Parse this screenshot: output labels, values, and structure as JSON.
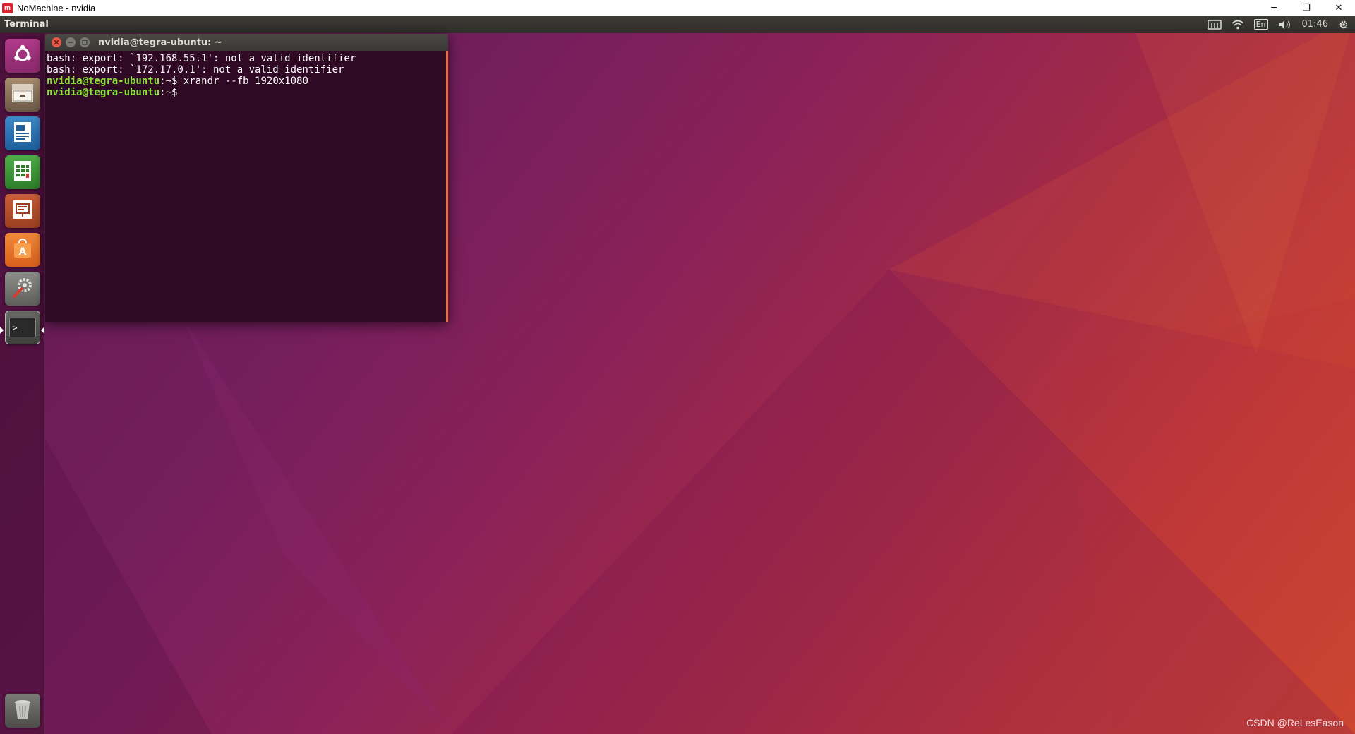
{
  "host_window": {
    "logo_text": "m",
    "title": "NoMachine - nvidia",
    "controls": {
      "minimize": "─",
      "restore": "❐",
      "close": "✕"
    }
  },
  "top_panel": {
    "app_name": "Terminal",
    "tray": {
      "keyboard_badge": "En",
      "clock": "01:46"
    }
  },
  "launcher": {
    "items": [
      {
        "name": "ubuntu-dash",
        "icon": "ubuntu-logo-icon"
      },
      {
        "name": "files",
        "icon": "file-cabinet-icon"
      },
      {
        "name": "writer",
        "icon": "writer-document-icon"
      },
      {
        "name": "calc",
        "icon": "spreadsheet-icon"
      },
      {
        "name": "impress",
        "icon": "presentation-icon"
      },
      {
        "name": "software",
        "icon": "shopping-bag-icon"
      },
      {
        "name": "settings",
        "icon": "settings-tools-icon"
      },
      {
        "name": "terminal",
        "icon": "terminal-icon",
        "active": true
      },
      {
        "name": "trash",
        "icon": "trash-icon"
      }
    ],
    "terminal_glyph": ">_"
  },
  "terminal": {
    "title": "nvidia@tegra-ubuntu: ~",
    "lines": [
      {
        "text": "bash: export: `192.168.55.1': not a valid identifier"
      },
      {
        "text": "bash: export: `172.17.0.1': not a valid identifier"
      },
      {
        "prompt": "nvidia@tegra-ubuntu",
        "path": ":~$",
        "command": " xrandr --fb 1920x1080"
      },
      {
        "prompt": "nvidia@tegra-ubuntu",
        "path": ":~$",
        "command": " "
      }
    ]
  },
  "watermark": "CSDN @ReLesEason",
  "colors": {
    "terminal_bg": "#300a24",
    "prompt_green": "#8ae234",
    "accent_orange": "#e9743a"
  }
}
